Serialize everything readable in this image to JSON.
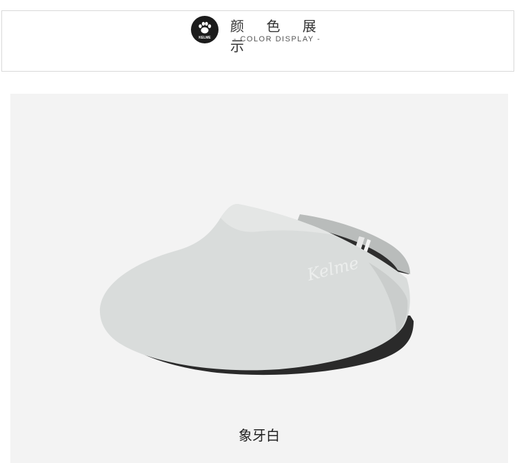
{
  "header": {
    "title_cn": "颜 色 展 示",
    "title_en": "- COLOR DISPLAY -",
    "logo": {
      "text": "KELME",
      "icon": "paw-icon"
    }
  },
  "product": {
    "color_name": "象牙白",
    "embossed_logo": "Kelme",
    "colors": {
      "visor": "#d9dcdb",
      "underside": "#2a2a2a",
      "panel": "#f3f3f3"
    }
  }
}
